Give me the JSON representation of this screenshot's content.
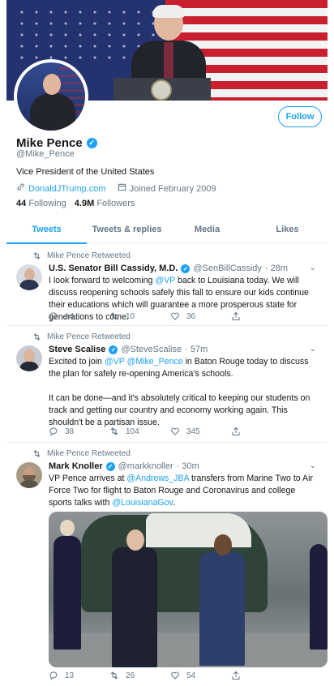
{
  "profile": {
    "name": "Mike Pence",
    "handle": "@Mike_Pence",
    "bio": "Vice President of the United States",
    "website": "DonaldJTrump.com",
    "joined": "Joined February 2009",
    "following_count": "44",
    "following_label": "Following",
    "followers_count": "4.9M",
    "followers_label": "Followers",
    "follow_button": "Follow",
    "verified_glyph": "✓"
  },
  "tabs": [
    "Tweets",
    "Tweets & replies",
    "Media",
    "Likes"
  ],
  "active_tab": "Tweets",
  "tweets": [
    {
      "retweet_label": "Mike Pence Retweeted",
      "author": "U.S. Senator Bill Cassidy, M.D.",
      "handle": "@SenBillCassidy",
      "time": "· 28m",
      "text_parts": [
        "I look forward to welcoming ",
        "@VP",
        " back to Louisiana today. We will discuss reopening schools safely this fall to ensure our kids continue their educations which will guarantee a more prosperous state for generations to come."
      ],
      "replies": "14",
      "retweets": "10",
      "likes": "36"
    },
    {
      "retweet_label": "Mike Pence Retweeted",
      "author": "Steve Scalise",
      "handle": "@SteveScalise",
      "time": "· 57m",
      "text_parts": [
        "Excited to join ",
        "@VP",
        " ",
        "@Mike_Pence",
        " in Baton Rouge today to discuss the plan for safely re-opening America's schools."
      ],
      "text2": "It can be done—and it's absolutely critical to keeping our students on track and getting our country and economy working again. This shouldn't be a partisan issue.",
      "replies": "38",
      "retweets": "104",
      "likes": "345"
    },
    {
      "retweet_label": "Mike Pence Retweeted",
      "author": "Mark Knoller",
      "handle": "@markknoller",
      "time": "· 30m",
      "text_parts": [
        "VP Pence arrives at ",
        "@Andrews_JBA",
        " transfers from Marine Two to Air Force Two for flight to Baton Rouge and Coronavirus and college sports talks with ",
        "@LouisianaGov",
        "."
      ],
      "replies": "13",
      "retweets": "26",
      "likes": "54"
    }
  ],
  "icons": {
    "retweet": "retweet-icon",
    "reply": "reply-icon",
    "like": "heart-icon",
    "share": "share-icon",
    "link": "link-icon",
    "calendar": "calendar-icon"
  },
  "colors": {
    "accent": "#1da1f2",
    "muted": "#657786",
    "text": "#14171a"
  }
}
